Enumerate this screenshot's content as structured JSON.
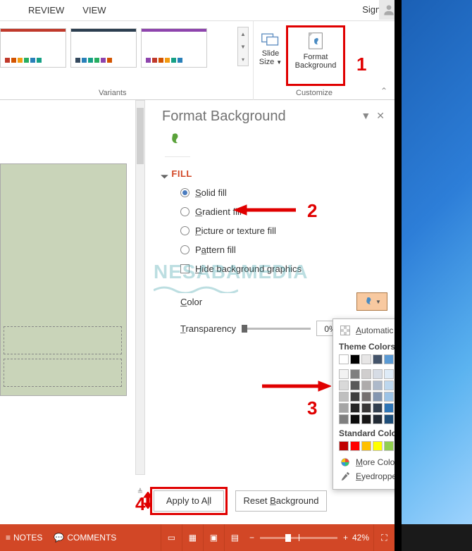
{
  "ribbon": {
    "tabs": [
      "REVIEW",
      "VIEW"
    ],
    "sign_in": "Sign in",
    "variants_label": "Variants",
    "customize_label": "Customize",
    "slide_size": "Slide Size",
    "format_bg": "Format Background"
  },
  "pane": {
    "title": "Format Background",
    "fill_header": "FILL",
    "options": {
      "solid": "Solid fill",
      "gradient": "Gradient fill",
      "picture": "Picture or texture fill",
      "pattern": "Pattern fill",
      "hide_bg": "Hide background graphics"
    },
    "color_label": "Color",
    "transparency_label": "Transparency",
    "transparency_value": "0%",
    "apply_all": "Apply to All",
    "reset_bg": "Reset Background"
  },
  "color_popover": {
    "automatic": "Automatic",
    "theme_section": "Theme Colors",
    "standard_section": "Standard Colors",
    "more_colors": "More Colors...",
    "eyedropper": "Eyedropper",
    "theme_top": [
      "#ffffff",
      "#000000",
      "#e7e6e6",
      "#44546a",
      "#5b9bd5",
      "#ed7d31",
      "#a5a5a5",
      "#ffc000",
      "#4472c4",
      "#70ad47"
    ],
    "theme_shades": [
      [
        "#f2f2f2",
        "#7f7f7f",
        "#d0cece",
        "#d6dce5",
        "#deebf7",
        "#fbe5d6",
        "#ededed",
        "#fff2cc",
        "#d9e2f3",
        "#e2efda"
      ],
      [
        "#d9d9d9",
        "#595959",
        "#aeabab",
        "#adb9ca",
        "#bdd7ee",
        "#f7cbac",
        "#dbdbdb",
        "#ffe699",
        "#b4c6e7",
        "#c5e0b4"
      ],
      [
        "#bfbfbf",
        "#3f3f3f",
        "#757070",
        "#8496b0",
        "#9cc3e6",
        "#f4b183",
        "#c9c9c9",
        "#ffd965",
        "#8eaadb",
        "#a8d08d"
      ],
      [
        "#a5a5a5",
        "#262626",
        "#3a3838",
        "#323f4f",
        "#2e75b6",
        "#c55a11",
        "#7b7b7b",
        "#bf9000",
        "#2f5496",
        "#538135"
      ],
      [
        "#7f7f7f",
        "#0c0c0c",
        "#171616",
        "#222a35",
        "#1e4e79",
        "#833c0b",
        "#525252",
        "#7f6000",
        "#1f3864",
        "#375623"
      ]
    ],
    "standard": [
      "#c00000",
      "#ff0000",
      "#ffc000",
      "#ffff00",
      "#92d050",
      "#00b050",
      "#00b0f0",
      "#0070c0",
      "#002060",
      "#7030a0"
    ]
  },
  "statusbar": {
    "notes": "NOTES",
    "comments": "COMMENTS",
    "zoom": "42%"
  },
  "annotations": {
    "a1": "1",
    "a2": "2",
    "a3": "3",
    "a4": "4"
  },
  "watermark": "NESABAMEDIA"
}
